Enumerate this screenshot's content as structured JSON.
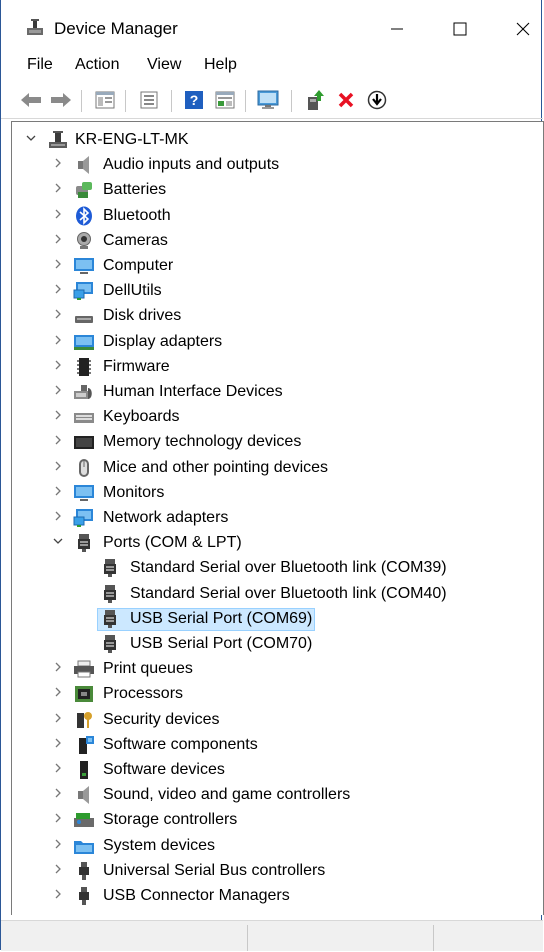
{
  "window": {
    "title": "Device Manager",
    "icon": "device-manager-icon",
    "minimize": "—",
    "maximize": "☐",
    "close": "✕"
  },
  "menu": [
    "File",
    "Action",
    "View",
    "Help"
  ],
  "toolbar": [
    "back-icon",
    "forward-icon",
    "properties-view-icon",
    "properties-icon",
    "help-icon",
    "driver-details-icon",
    "scan-monitor-icon",
    "update-driver-icon",
    "uninstall-icon",
    "disable-icon"
  ],
  "tree": {
    "root": "KR-ENG-LT-MK",
    "categories": [
      {
        "label": "Audio inputs and outputs",
        "icon": "speaker-icon",
        "expanded": false
      },
      {
        "label": "Batteries",
        "icon": "battery-icon",
        "expanded": false
      },
      {
        "label": "Bluetooth",
        "icon": "bluetooth-icon",
        "expanded": false
      },
      {
        "label": "Cameras",
        "icon": "camera-icon",
        "expanded": false
      },
      {
        "label": "Computer",
        "icon": "computer-icon",
        "expanded": false
      },
      {
        "label": "DellUtils",
        "icon": "network-monitor-icon",
        "expanded": false
      },
      {
        "label": "Disk drives",
        "icon": "disk-drive-icon",
        "expanded": false
      },
      {
        "label": "Display adapters",
        "icon": "display-adapter-icon",
        "expanded": false
      },
      {
        "label": "Firmware",
        "icon": "chip-icon",
        "expanded": false
      },
      {
        "label": "Human Interface Devices",
        "icon": "hid-icon",
        "expanded": false
      },
      {
        "label": "Keyboards",
        "icon": "keyboard-icon",
        "expanded": false
      },
      {
        "label": "Memory technology devices",
        "icon": "memory-icon",
        "expanded": false
      },
      {
        "label": "Mice and other pointing devices",
        "icon": "mouse-icon",
        "expanded": false
      },
      {
        "label": "Monitors",
        "icon": "monitor-icon",
        "expanded": false
      },
      {
        "label": "Network adapters",
        "icon": "network-adapter-icon",
        "expanded": false
      },
      {
        "label": "Ports (COM & LPT)",
        "icon": "port-icon",
        "expanded": true,
        "children": [
          {
            "label": "Standard Serial over Bluetooth link (COM39)",
            "icon": "port-icon"
          },
          {
            "label": "Standard Serial over Bluetooth link (COM40)",
            "icon": "port-icon"
          },
          {
            "label": "USB Serial Port (COM69)",
            "icon": "port-icon",
            "selected": true
          },
          {
            "label": "USB Serial Port (COM70)",
            "icon": "port-icon"
          }
        ]
      },
      {
        "label": "Print queues",
        "icon": "printer-icon",
        "expanded": false
      },
      {
        "label": "Processors",
        "icon": "processor-icon",
        "expanded": false
      },
      {
        "label": "Security devices",
        "icon": "security-key-icon",
        "expanded": false
      },
      {
        "label": "Software components",
        "icon": "software-component-icon",
        "expanded": false
      },
      {
        "label": "Software devices",
        "icon": "software-device-icon",
        "expanded": false
      },
      {
        "label": "Sound, video and game controllers",
        "icon": "speaker-icon",
        "expanded": false
      },
      {
        "label": "Storage controllers",
        "icon": "storage-controller-icon",
        "expanded": false
      },
      {
        "label": "System devices",
        "icon": "system-folder-icon",
        "expanded": false
      },
      {
        "label": "Universal Serial Bus controllers",
        "icon": "usb-icon",
        "expanded": false
      },
      {
        "label": "USB Connector Managers",
        "icon": "usb-icon",
        "expanded": false
      }
    ]
  },
  "colors": {
    "selection_bg": "#cce8ff",
    "selection_border": "#99d1ff",
    "uninstall_red": "#e81123",
    "help_blue": "#1f5fbf",
    "update_green": "#2e9b2e"
  }
}
